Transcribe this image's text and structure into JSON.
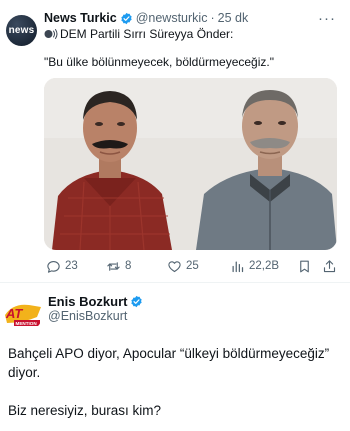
{
  "quoted_tweet": {
    "avatar_text": "news",
    "display_name": "News Turkic",
    "handle": "@newsturkic",
    "separator": "·",
    "time": "25 dk",
    "more_label": "···",
    "line1": "DEM Partili Sırrı Süreyya Önder:",
    "line2": "\"Bu ülke bölünmeyecek, böldürmeyeceğiz.\"",
    "metrics": {
      "replies": "23",
      "retweets": "8",
      "likes": "25",
      "views": "22,2B"
    }
  },
  "reply_tweet": {
    "avatar_text": "AT",
    "avatar_subtext": "MENTION",
    "display_name": "Enis Bozkurt",
    "handle": "@EnisBozkurt",
    "paragraph1": "Bahçeli APO diyor, Apocular “ülkeyi böldürmeyeceğiz” diyor.",
    "paragraph2": "Biz neresiyiz, burası kim?"
  },
  "colors": {
    "verified_blue": "#1d9bf0",
    "muted_text": "#536471",
    "primary_text": "#0f1419"
  }
}
